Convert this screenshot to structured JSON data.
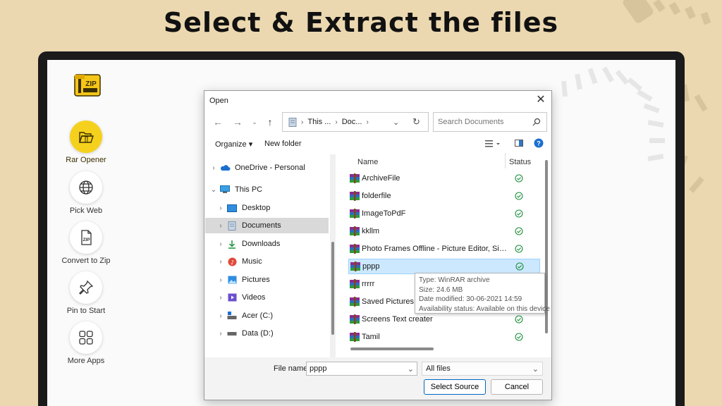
{
  "headline": "Select & Extract the files",
  "app": {
    "logo_text": "ZIP",
    "nav": [
      {
        "label": "Rar Opener",
        "icon": "folder-open-icon",
        "active": true
      },
      {
        "label": "Pick Web",
        "icon": "globe-icon",
        "active": false
      },
      {
        "label": "Convert to Zip",
        "icon": "zip-file-icon",
        "active": false
      },
      {
        "label": "Pin to Start",
        "icon": "pin-icon",
        "active": false
      },
      {
        "label": "More Apps",
        "icon": "grid-apps-icon",
        "active": false
      }
    ],
    "accent_color": "#f5d11d"
  },
  "dialog": {
    "title": "Open",
    "address": {
      "crumbs": [
        "This ...",
        "Doc..."
      ]
    },
    "search_placeholder": "Search Documents",
    "toolbar": {
      "organize": "Organize ▾",
      "new_folder": "New folder"
    },
    "tree": [
      {
        "label": "OneDrive - Personal",
        "icon": "cloud-icon",
        "level": 0,
        "expanded": false
      },
      {
        "label": "This PC",
        "icon": "computer-icon",
        "level": 0,
        "expanded": true
      },
      {
        "label": "Desktop",
        "icon": "desktop-folder-icon",
        "level": 1
      },
      {
        "label": "Documents",
        "icon": "documents-folder-icon",
        "level": 1,
        "selected": true
      },
      {
        "label": "Downloads",
        "icon": "download-icon",
        "level": 1
      },
      {
        "label": "Music",
        "icon": "music-icon",
        "level": 1
      },
      {
        "label": "Pictures",
        "icon": "pictures-icon",
        "level": 1
      },
      {
        "label": "Videos",
        "icon": "videos-icon",
        "level": 1
      },
      {
        "label": "Acer (C:)",
        "icon": "drive-c-icon",
        "level": 1
      },
      {
        "label": "Data (D:)",
        "icon": "drive-d-icon",
        "level": 1
      }
    ],
    "columns": {
      "name": "Name",
      "status": "Status"
    },
    "files": [
      {
        "name": "ArchiveFile"
      },
      {
        "name": "folderfile"
      },
      {
        "name": "ImageToPdF"
      },
      {
        "name": "kkllm"
      },
      {
        "name": "Photo Frames Offline - Picture Editor, Simple and Fast"
      },
      {
        "name": "pppp",
        "selected": true
      },
      {
        "name": "rrrrr"
      },
      {
        "name": "Saved Pictures"
      },
      {
        "name": "Screens Text creater"
      },
      {
        "name": "Tamil"
      }
    ],
    "tooltip": {
      "type": "Type: WinRAR archive",
      "size": "Size: 24.6 MB",
      "modified": "Date modified: 30-06-2021 14:59",
      "availability": "Availability status: Available on this device"
    },
    "footer": {
      "file_name_label": "File name:",
      "file_name_value": "pppp",
      "filter": "All files",
      "primary_button": "Select Source",
      "cancel_button": "Cancel"
    }
  }
}
